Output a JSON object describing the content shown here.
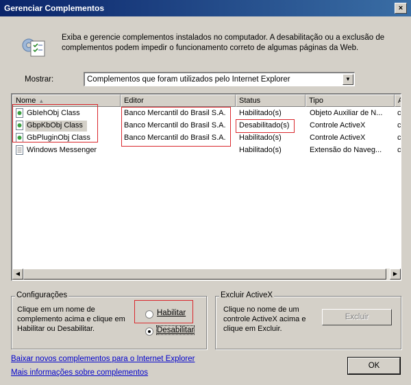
{
  "window": {
    "title": "Gerenciar Complementos",
    "close_glyph": "×"
  },
  "description": "Exiba e gerencie complementos instalados no computador. A desabilitação ou a exclusão de complementos podem impedir o funcionamento correto de algumas páginas da Web.",
  "show": {
    "label": "Mostrar:",
    "selected": "Complementos que foram utilizados pelo Internet Explorer"
  },
  "list": {
    "columns": [
      "Nome",
      "Editor",
      "Status",
      "Tipo",
      "A"
    ],
    "rows": [
      {
        "name": "GbIehObj Class",
        "editor": "Banco Mercantil do Brasil S.A.",
        "status": "Habilitado(s)",
        "type": "Objeto Auxiliar de N...",
        "extra": "c"
      },
      {
        "name": "GbpKbObj Class",
        "editor": "Banco Mercantil do Brasil S.A.",
        "status": "Desabilitado(s)",
        "type": "Controle ActiveX",
        "extra": "c"
      },
      {
        "name": "GbPluginObj Class",
        "editor": "Banco Mercantil do Brasil S.A.",
        "status": "Habilitado(s)",
        "type": "Controle ActiveX",
        "extra": "c"
      },
      {
        "name": "Windows Messenger",
        "editor": "",
        "status": "Habilitado(s)",
        "type": "Extensão do Naveg...",
        "extra": "c"
      }
    ]
  },
  "config": {
    "title": "Configurações",
    "text": [
      "Clique em um nome de",
      "complemento acima e clique em",
      "Habilitar ou Desabilitar."
    ],
    "enable_label": "Habilitar",
    "disable_label": "Desabilitar",
    "selected": "disable"
  },
  "activex": {
    "title": "Excluir ActiveX",
    "text": [
      "Clique no nome de um",
      "controle ActiveX acima e",
      "clique em Excluir."
    ],
    "delete_label": "Excluir"
  },
  "links": {
    "download": "Baixar novos complementos para o Internet Explorer",
    "more_info": "Mais informações sobre complementos"
  },
  "ok_label": "OK",
  "colors": {
    "titlebar": "#0a246a",
    "highlight_box": "#d9262b",
    "link": "#0000cc"
  }
}
